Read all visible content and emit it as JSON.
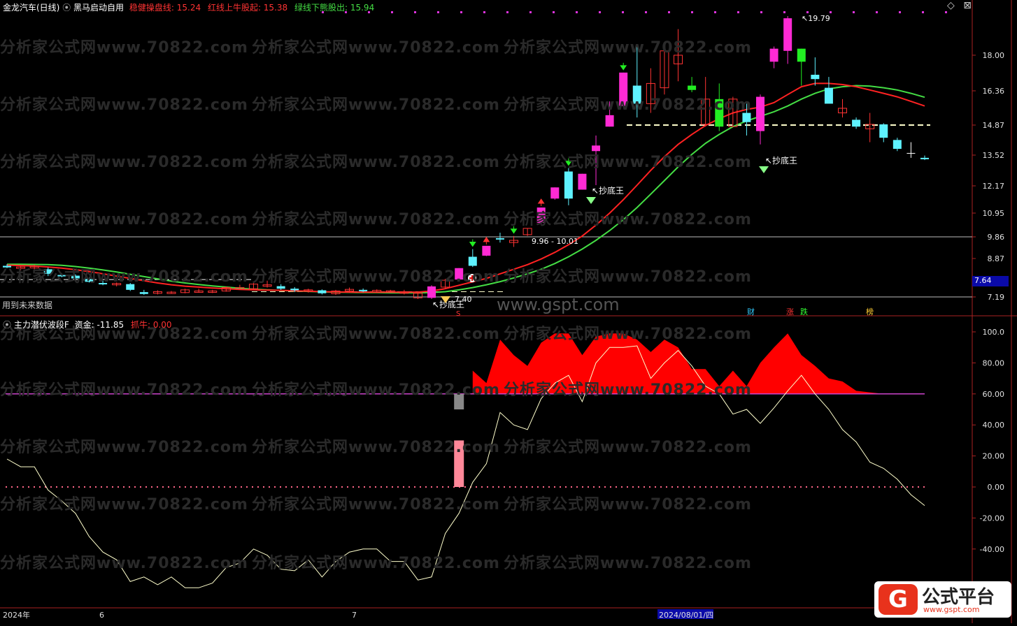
{
  "header": {
    "stock": "金龙汽车(日线)",
    "indicator": "黑马启动自用",
    "l1_label": "稳健操盘线: ",
    "l1_value": "15.24",
    "l2_label": "红线上牛股起: ",
    "l2_value": "15.38",
    "l3_label": "绿线下熊股出: ",
    "l3_value": "15.94"
  },
  "lower_header": {
    "name": "主力潜伏波段F",
    "f1_label": "资金: ",
    "f1_value": "-11.85",
    "f2_label": "抓牛: ",
    "f2_value": "0.00"
  },
  "future_text": "用到未来数据",
  "price_tag": "7.64",
  "watermarks": {
    "main": "分析家公式网www.70822.com",
    "site": "www.gspt.com"
  },
  "brand": {
    "name": "公式平台",
    "url": "www.gspt.com",
    "glyph": "G"
  },
  "annotations": {
    "peak": "19.79",
    "range": "9.96 - 10.01",
    "chaodi1": "抄底王",
    "chaodi2": "抄底王",
    "chaodi3": "抄底王",
    "low": "7.40",
    "s": "S"
  },
  "events": [
    "财",
    "涨",
    "跌",
    "榜"
  ],
  "date_axis": [
    "2024年",
    "6",
    "7",
    "2024/08/01/四"
  ],
  "colors": {
    "up": "#ff2ad4",
    "down": "#5ef2ff",
    "red_line": "#ff2222",
    "green_line": "#44dd44",
    "green_candle": "#22ee22",
    "hollow_red": "#ff3333",
    "area": "#ff0000",
    "purple": "#cc44cc",
    "pink": "#ff8899"
  },
  "chart_data": [
    {
      "type": "candlestick",
      "y_ticks": [
        "18.00",
        "16.36",
        "14.87",
        "13.52",
        "12.17",
        "10.95",
        "9.86",
        "8.87",
        "7.19"
      ],
      "y_values": [
        18.0,
        16.36,
        14.87,
        13.52,
        12.17,
        10.95,
        9.86,
        8.87,
        7.19
      ],
      "candles": [
        {
          "o": 8.55,
          "h": 8.62,
          "l": 8.45,
          "c": 8.48,
          "k": "down"
        },
        {
          "o": 8.45,
          "h": 8.55,
          "l": 8.35,
          "c": 8.5,
          "k": "hollow"
        },
        {
          "o": 8.48,
          "h": 8.6,
          "l": 8.4,
          "c": 8.52,
          "k": "hollow"
        },
        {
          "o": 8.4,
          "h": 8.48,
          "l": 8.1,
          "c": 8.2,
          "k": "down"
        },
        {
          "o": 8.15,
          "h": 8.22,
          "l": 8.05,
          "c": 8.1,
          "k": "down"
        },
        {
          "o": 8.12,
          "h": 8.18,
          "l": 7.95,
          "c": 8.0,
          "k": "down"
        },
        {
          "o": 7.98,
          "h": 8.05,
          "l": 7.82,
          "c": 7.85,
          "k": "down"
        },
        {
          "o": 7.8,
          "h": 7.9,
          "l": 7.7,
          "c": 7.75,
          "k": "down"
        },
        {
          "o": 7.72,
          "h": 7.82,
          "l": 7.65,
          "c": 7.78,
          "k": "hollow"
        },
        {
          "o": 7.75,
          "h": 7.8,
          "l": 7.45,
          "c": 7.5,
          "k": "down"
        },
        {
          "o": 7.4,
          "h": 7.5,
          "l": 7.28,
          "c": 7.32,
          "k": "down"
        },
        {
          "o": 7.35,
          "h": 7.48,
          "l": 7.3,
          "c": 7.42,
          "k": "hollow"
        },
        {
          "o": 7.4,
          "h": 7.45,
          "l": 7.35,
          "c": 7.38,
          "k": "hollow"
        },
        {
          "o": 7.38,
          "h": 7.55,
          "l": 7.35,
          "c": 7.5,
          "k": "hollow"
        },
        {
          "o": 7.45,
          "h": 7.55,
          "l": 7.4,
          "c": 7.42,
          "k": "hollow"
        },
        {
          "o": 7.42,
          "h": 7.5,
          "l": 7.36,
          "c": 7.45,
          "k": "hollow"
        },
        {
          "o": 7.45,
          "h": 7.65,
          "l": 7.42,
          "c": 7.6,
          "k": "hollow"
        },
        {
          "o": 7.6,
          "h": 7.72,
          "l": 7.5,
          "c": 7.55,
          "k": "hollow"
        },
        {
          "o": 7.55,
          "h": 7.8,
          "l": 7.5,
          "c": 7.75,
          "k": "hollow"
        },
        {
          "o": 7.72,
          "h": 7.9,
          "l": 7.6,
          "c": 7.68,
          "k": "hollow"
        },
        {
          "o": 7.66,
          "h": 7.75,
          "l": 7.5,
          "c": 7.55,
          "k": "down"
        },
        {
          "o": 7.55,
          "h": 7.62,
          "l": 7.4,
          "c": 7.48,
          "k": "down"
        },
        {
          "o": 7.45,
          "h": 7.55,
          "l": 7.38,
          "c": 7.5,
          "k": "hollow"
        },
        {
          "o": 7.48,
          "h": 7.52,
          "l": 7.3,
          "c": 7.35,
          "k": "down"
        },
        {
          "o": 7.33,
          "h": 7.5,
          "l": 7.28,
          "c": 7.45,
          "k": "hollow"
        },
        {
          "o": 7.45,
          "h": 7.6,
          "l": 7.38,
          "c": 7.52,
          "k": "hollow"
        },
        {
          "o": 7.5,
          "h": 7.56,
          "l": 7.4,
          "c": 7.45,
          "k": "down"
        },
        {
          "o": 7.44,
          "h": 7.52,
          "l": 7.36,
          "c": 7.48,
          "k": "hollow"
        },
        {
          "o": 7.46,
          "h": 7.5,
          "l": 7.38,
          "c": 7.42,
          "k": "hollow"
        },
        {
          "o": 7.42,
          "h": 7.5,
          "l": 7.3,
          "c": 7.35,
          "k": "hollow"
        },
        {
          "o": 7.35,
          "h": 7.4,
          "l": 7.1,
          "c": 7.15,
          "k": "hollow"
        },
        {
          "o": 7.15,
          "h": 7.7,
          "l": 7.1,
          "c": 7.65,
          "k": "up"
        },
        {
          "o": 7.62,
          "h": 7.98,
          "l": 7.55,
          "c": 7.92,
          "k": "hollow"
        },
        {
          "o": 7.95,
          "h": 8.45,
          "l": 7.9,
          "c": 8.45,
          "k": "up"
        },
        {
          "o": 8.55,
          "h": 9.3,
          "l": 8.5,
          "c": 8.95,
          "k": "down"
        },
        {
          "o": 9.0,
          "h": 9.45,
          "l": 8.98,
          "c": 9.45,
          "k": "up"
        },
        {
          "o": 9.8,
          "h": 10.05,
          "l": 9.6,
          "c": 9.8,
          "k": "down"
        },
        {
          "o": 9.7,
          "h": 9.9,
          "l": 9.4,
          "c": 9.6,
          "k": "hollow"
        },
        {
          "o": 9.96,
          "h": 10.25,
          "l": 9.9,
          "c": 10.25,
          "k": "hollow"
        },
        {
          "o": 10.5,
          "h": 11.2,
          "l": 10.45,
          "c": 11.2,
          "k": "up"
        },
        {
          "o": 11.6,
          "h": 12.1,
          "l": 11.55,
          "c": 12.1,
          "k": "up"
        },
        {
          "o": 12.8,
          "h": 12.95,
          "l": 11.3,
          "c": 11.6,
          "k": "down"
        },
        {
          "o": 12.0,
          "h": 12.7,
          "l": 12.0,
          "c": 12.7,
          "k": "up"
        },
        {
          "o": 13.7,
          "h": 14.4,
          "l": 12.2,
          "c": 13.95,
          "k": "up"
        },
        {
          "o": 14.8,
          "h": 15.9,
          "l": 14.8,
          "c": 15.3,
          "k": "up"
        },
        {
          "o": 15.7,
          "h": 17.2,
          "l": 15.7,
          "c": 17.2,
          "k": "up"
        },
        {
          "o": 15.8,
          "h": 18.5,
          "l": 15.2,
          "c": 16.6,
          "k": "down"
        },
        {
          "o": 15.8,
          "h": 17.4,
          "l": 15.4,
          "c": 16.7,
          "k": "hollow"
        },
        {
          "o": 16.5,
          "h": 18.4,
          "l": 16.2,
          "c": 18.2,
          "k": "hollow"
        },
        {
          "o": 18.0,
          "h": 19.2,
          "l": 16.8,
          "c": 17.6,
          "k": "hollow"
        },
        {
          "o": 16.6,
          "h": 17.0,
          "l": 16.3,
          "c": 16.4,
          "k": "green"
        },
        {
          "o": 14.9,
          "h": 17.0,
          "l": 14.8,
          "c": 16.0,
          "k": "hollow"
        },
        {
          "o": 16.0,
          "h": 16.7,
          "l": 14.6,
          "c": 14.8,
          "k": "green"
        },
        {
          "o": 14.8,
          "h": 16.1,
          "l": 14.8,
          "c": 16.0,
          "k": "hollow"
        },
        {
          "o": 15.4,
          "h": 15.8,
          "l": 14.4,
          "c": 15.0,
          "k": "down"
        },
        {
          "o": 14.6,
          "h": 16.2,
          "l": 14.0,
          "c": 16.1,
          "k": "up"
        },
        {
          "o": 18.3,
          "h": 18.4,
          "l": 17.4,
          "c": 17.7,
          "k": "up"
        },
        {
          "o": 18.2,
          "h": 19.8,
          "l": 17.6,
          "c": 19.7,
          "k": "up"
        },
        {
          "o": 18.3,
          "h": 18.3,
          "l": 16.6,
          "c": 17.7,
          "k": "green"
        },
        {
          "o": 16.9,
          "h": 17.9,
          "l": 16.6,
          "c": 17.1,
          "k": "down"
        },
        {
          "o": 16.5,
          "h": 17.0,
          "l": 15.9,
          "c": 15.8,
          "k": "down"
        },
        {
          "o": 15.6,
          "h": 16.0,
          "l": 15.2,
          "c": 15.4,
          "k": "hollow"
        },
        {
          "o": 15.1,
          "h": 15.2,
          "l": 14.7,
          "c": 14.8,
          "k": "down"
        },
        {
          "o": 14.9,
          "h": 15.4,
          "l": 14.1,
          "c": 14.7,
          "k": "hollow"
        },
        {
          "o": 14.9,
          "h": 14.95,
          "l": 14.1,
          "c": 14.3,
          "k": "down"
        },
        {
          "o": 14.2,
          "h": 14.3,
          "l": 13.7,
          "c": 13.8,
          "k": "down"
        },
        {
          "o": 13.6,
          "h": 14.1,
          "l": 13.4,
          "c": 13.55,
          "k": "cross"
        },
        {
          "o": 13.4,
          "h": 13.5,
          "l": 13.3,
          "c": 13.35,
          "k": "down"
        }
      ],
      "red_line": [
        8.58,
        8.56,
        8.54,
        8.5,
        8.45,
        8.38,
        8.3,
        8.2,
        8.1,
        8.0,
        7.9,
        7.8,
        7.72,
        7.66,
        7.62,
        7.58,
        7.55,
        7.52,
        7.5,
        7.49,
        7.48,
        7.46,
        7.44,
        7.42,
        7.41,
        7.4,
        7.4,
        7.4,
        7.4,
        7.4,
        7.4,
        7.45,
        7.55,
        7.7,
        7.85,
        8.0,
        8.2,
        8.4,
        8.6,
        8.85,
        9.15,
        9.5,
        9.9,
        10.4,
        10.95,
        11.55,
        12.2,
        12.85,
        13.45,
        14.0,
        14.45,
        14.85,
        15.15,
        15.4,
        15.55,
        15.65,
        15.85,
        16.2,
        16.55,
        16.7,
        16.7,
        16.65,
        16.55,
        16.4,
        16.25,
        16.1,
        15.9,
        15.7
      ],
      "green_line": [
        8.62,
        8.62,
        8.61,
        8.6,
        8.57,
        8.52,
        8.45,
        8.37,
        8.28,
        8.18,
        8.08,
        7.98,
        7.88,
        7.8,
        7.73,
        7.67,
        7.62,
        7.57,
        7.53,
        7.5,
        7.47,
        7.45,
        7.43,
        7.41,
        7.4,
        7.39,
        7.38,
        7.38,
        7.37,
        7.37,
        7.37,
        7.38,
        7.42,
        7.5,
        7.6,
        7.72,
        7.86,
        8.02,
        8.2,
        8.4,
        8.65,
        8.95,
        9.3,
        9.7,
        10.15,
        10.65,
        11.2,
        11.8,
        12.4,
        13.0,
        13.55,
        14.05,
        14.45,
        14.8,
        15.05,
        15.25,
        15.45,
        15.7,
        16.0,
        16.25,
        16.45,
        16.55,
        16.6,
        16.58,
        16.5,
        16.4,
        16.25,
        16.08
      ],
      "dash_levels": [
        7.95,
        14.87,
        7.42
      ],
      "h_lines": [
        9.86,
        7.19
      ]
    },
    {
      "type": "area",
      "series_labels": [
        "资金",
        "抓牛"
      ],
      "y_ticks": [
        "100.0",
        "80.00",
        "60.00",
        "40.00",
        "20.00",
        "0.00",
        "-20.00",
        "-40.00"
      ],
      "y_values": [
        100,
        80,
        60,
        40,
        20,
        0,
        -20,
        -40
      ],
      "white_line": [
        18,
        13,
        13,
        -2,
        -9,
        -17,
        -32,
        -42,
        -47,
        -61,
        -58,
        -63,
        -58,
        -65,
        -65,
        -62,
        -52,
        -49,
        -40,
        -44,
        -53,
        -54,
        -47,
        -58,
        -48,
        -42,
        -40,
        -40,
        -48,
        -48,
        -60,
        -58,
        -30,
        -17,
        3,
        15,
        48,
        40,
        37,
        57,
        67,
        72,
        55,
        80,
        90,
        90,
        91,
        70,
        80,
        88,
        78,
        65,
        60,
        47,
        50,
        41,
        51,
        62,
        72,
        60,
        50,
        37,
        29,
        16,
        12,
        5,
        -5,
        -12
      ],
      "red_area": [
        null,
        null,
        null,
        null,
        null,
        null,
        null,
        null,
        null,
        null,
        null,
        null,
        null,
        null,
        null,
        null,
        null,
        null,
        null,
        null,
        null,
        null,
        null,
        null,
        null,
        null,
        null,
        null,
        null,
        null,
        null,
        null,
        null,
        null,
        75,
        67,
        95,
        85,
        78,
        93,
        99,
        99,
        85,
        97,
        99,
        99,
        95,
        87,
        95,
        90,
        76,
        76,
        65,
        75,
        65,
        80,
        90,
        99,
        85,
        78,
        70,
        68,
        62,
        61,
        60,
        null,
        null,
        null
      ],
      "baseline_purple": 60,
      "baseline_dotted": 0,
      "gray_bar": [
        60,
        50
      ],
      "pink_bar": [
        30,
        0
      ]
    }
  ]
}
